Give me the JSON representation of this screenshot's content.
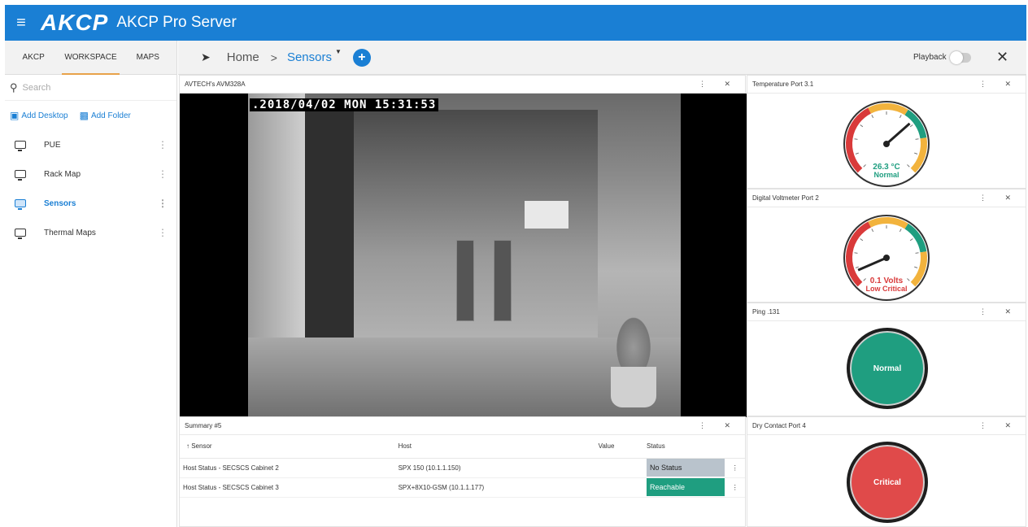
{
  "app": {
    "logo": "AKCP",
    "title": "AKCP Pro Server"
  },
  "left": {
    "tabs": [
      "AKCP",
      "WORKSPACE",
      "MAPS"
    ],
    "search_placeholder": "Search",
    "add_desktop": "Add Desktop",
    "add_folder": "Add Folder",
    "items": [
      {
        "label": "PUE"
      },
      {
        "label": "Rack Map"
      },
      {
        "label": "Sensors",
        "active": true
      },
      {
        "label": "Thermal Maps"
      }
    ]
  },
  "toolbar": {
    "home": "Home",
    "sep": ">",
    "current": "Sensors",
    "playback": "Playback"
  },
  "camera": {
    "title": "AVTECH's AVM328A",
    "timestamp": ".2018/04/02 MON 15:31:53"
  },
  "summary": {
    "title": "Summary #5",
    "columns": [
      "↑ Sensor",
      "Host",
      "Value",
      "Status"
    ],
    "rows": [
      {
        "sensor": "Host Status - SECSCS Cabinet 2",
        "host": "SPX 150 (10.1.1.150)",
        "value": "",
        "status": "No Status"
      },
      {
        "sensor": "Host Status - SECSCS Cabinet 3",
        "host": "SPX+8X10-GSM (10.1.1.177)",
        "value": "",
        "status": "Reachable"
      }
    ]
  },
  "widgets": {
    "temp": {
      "title": "Temperature Port 3.1",
      "value": "26.3 °C",
      "state": "Normal",
      "fraction": 0.68,
      "state_color": "#1f9e80"
    },
    "volt": {
      "title": "Digital Voltmeter Port 2",
      "value": "0.1 Volts",
      "state": "Low Critical",
      "fraction": 0.08,
      "state_color": "#d93a3a"
    },
    "ping": {
      "title": "Ping .131",
      "state": "Normal",
      "color": "#1f9e80"
    },
    "dry": {
      "title": "Dry Contact Port 4",
      "state": "Critical",
      "color": "#e04a4a"
    }
  },
  "colors": {
    "accent": "#1a7fd4",
    "ok": "#1f9e80",
    "critical": "#e04a4a",
    "warn": "#f2b33d"
  }
}
